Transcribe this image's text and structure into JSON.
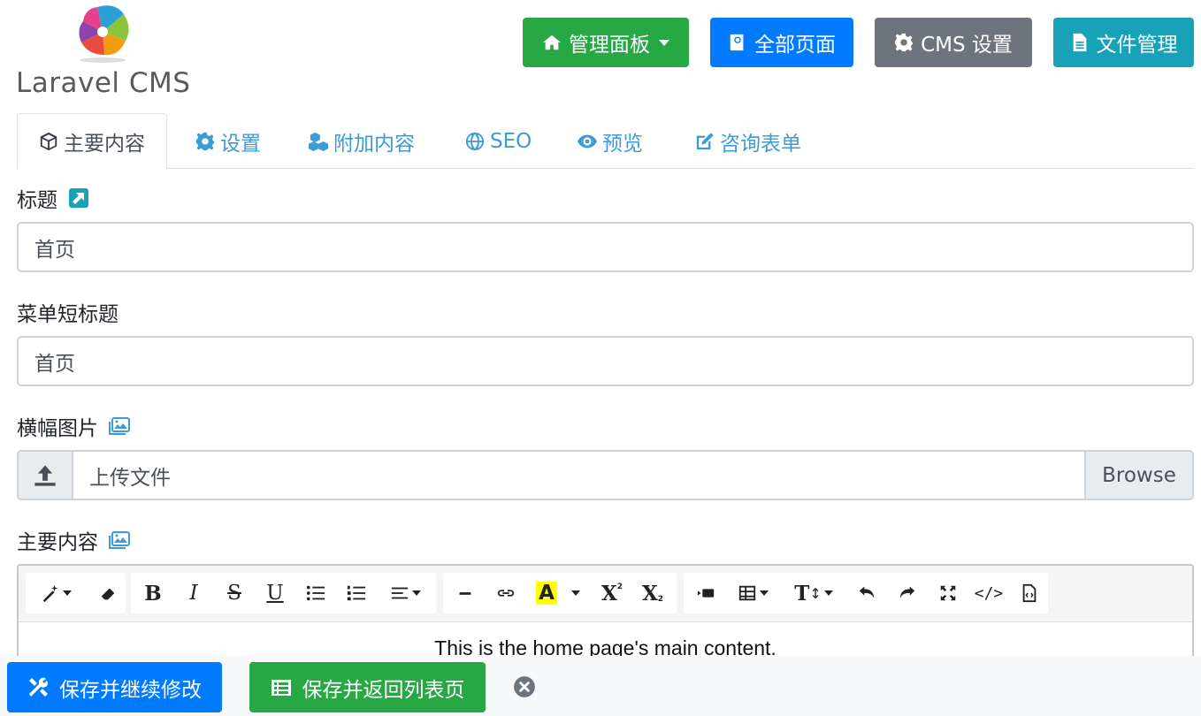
{
  "app": {
    "logo_text": "Laravel CMS"
  },
  "header": {
    "dashboard_label": "管理面板",
    "all_pages_label": "全部页面",
    "cms_settings_label": "CMS 设置",
    "file_manager_label": "文件管理"
  },
  "tabs": [
    {
      "label": "主要内容",
      "icon": "cube-icon",
      "active": true
    },
    {
      "label": "设置",
      "icon": "gear-icon"
    },
    {
      "label": "附加内容",
      "icon": "cubes-icon"
    },
    {
      "label": "SEO",
      "icon": "globe-icon"
    },
    {
      "label": "预览",
      "icon": "eye-icon"
    },
    {
      "label": "咨询表单",
      "icon": "edit-icon"
    }
  ],
  "form": {
    "title_label": "标题",
    "title_value": "首页",
    "menu_title_label": "菜单短标题",
    "menu_title_value": "首页",
    "banner_label": "横幅图片",
    "upload_text": "上传文件",
    "browse_label": "Browse",
    "main_content_label": "主要内容"
  },
  "editor": {
    "content": "This is the home page's main content.",
    "toolbar": [
      "magic-icon",
      "eraser-icon",
      "bold",
      "italic",
      "strikethrough",
      "underline",
      "unordered-list-icon",
      "ordered-list-icon",
      "align-icon",
      "horizontal-rule-icon",
      "link-icon",
      "font-color-icon",
      "superscript",
      "subscript",
      "video-icon",
      "table-icon",
      "font-size-icon",
      "undo-icon",
      "redo-icon",
      "fullscreen-icon",
      "code-view-icon",
      "help-icon"
    ],
    "bold_glyph": "B",
    "italic_glyph": "I",
    "strike_glyph": "S",
    "underline_glyph": "U",
    "color_glyph": "A",
    "sup_glyph": "X",
    "sub_glyph": "X",
    "fontsize_glyph": "T",
    "code_glyph": "</>"
  },
  "footer": {
    "save_continue_label": "保存并继续修改",
    "save_return_label": "保存并返回列表页"
  },
  "colors": {
    "green": "#28a745",
    "blue": "#007bff",
    "gray": "#6c757d",
    "teal": "#17a2b8",
    "link": "#3d9bd6"
  }
}
